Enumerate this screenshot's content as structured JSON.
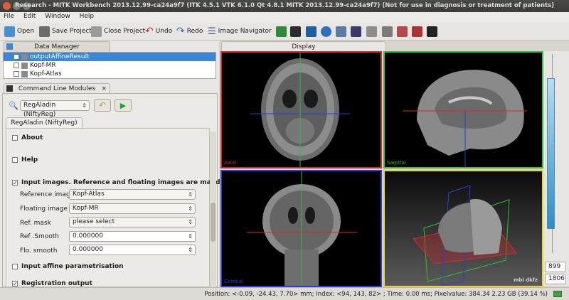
{
  "window": {
    "title": "Research - MITK Workbench 2013.12.99-ca24a9f7 (ITK 4.5.1  VTK 6.1.0 Qt 4.8.1 MITK 2013.12.99-ca24a9f7) (Not for use in diagnosis or treatment of patients)"
  },
  "menu": [
    "File",
    "Edit",
    "Window",
    "Help"
  ],
  "toolbar": {
    "open": "Open",
    "save_project": "Save Project",
    "close_project": "Close Project",
    "undo": "Undo",
    "redo": "Redo",
    "image_navigator": "Image Navigator"
  },
  "data_manager": {
    "tab": "Data Manager",
    "items": [
      {
        "label": "outputAffineResult",
        "selected": true
      },
      {
        "label": "Kopf-MR",
        "selected": false
      },
      {
        "label": "Kopf-Atlas",
        "selected": false
      }
    ]
  },
  "cmd": {
    "tab": "Command Line Modules",
    "module_select": "RegAladin (NiftyReg)",
    "module_tab": "RegAladin (NiftyReg)",
    "about": "About",
    "help": "Help",
    "input_group": "Input images. Reference and floating images are mandatory",
    "reference_label": "Reference image",
    "reference_value": "Kopf-Atlas",
    "floating_label": "Floating image",
    "floating_value": "Kopf-MR",
    "refmask_label": "Ref. mask",
    "refmask_value": "please select",
    "refsmooth_label": "Ref .Smooth",
    "refsmooth_value": "0.000000",
    "flosmooth_label": "Flo. smooth",
    "flosmooth_value": "0.000000",
    "affine_group": "Input affine parametrisation",
    "output_group": "Registration output"
  },
  "display": {
    "tab": "Display",
    "axial": "Axial",
    "sagittal": "Sagittal",
    "coronal": "Coronal",
    "logo": "mbi dkfz",
    "slider_top": "899",
    "slider_bottom": "1806",
    "slider_level": 0.58
  },
  "status": {
    "text": "Position: <-0.09, -24.43, 7.70> mm; Index: <94, 143, 82> ; Time: 0.00 ms; Pixelvalue: 384.34     2.23 GB (39.14 %)"
  },
  "colors": {
    "axial_border": "#d52b2b",
    "sagittal_border": "#2fbf2f",
    "coronal_border": "#2a3fd4",
    "threed_border": "#e6d33a",
    "selection": "#3c86d4"
  }
}
